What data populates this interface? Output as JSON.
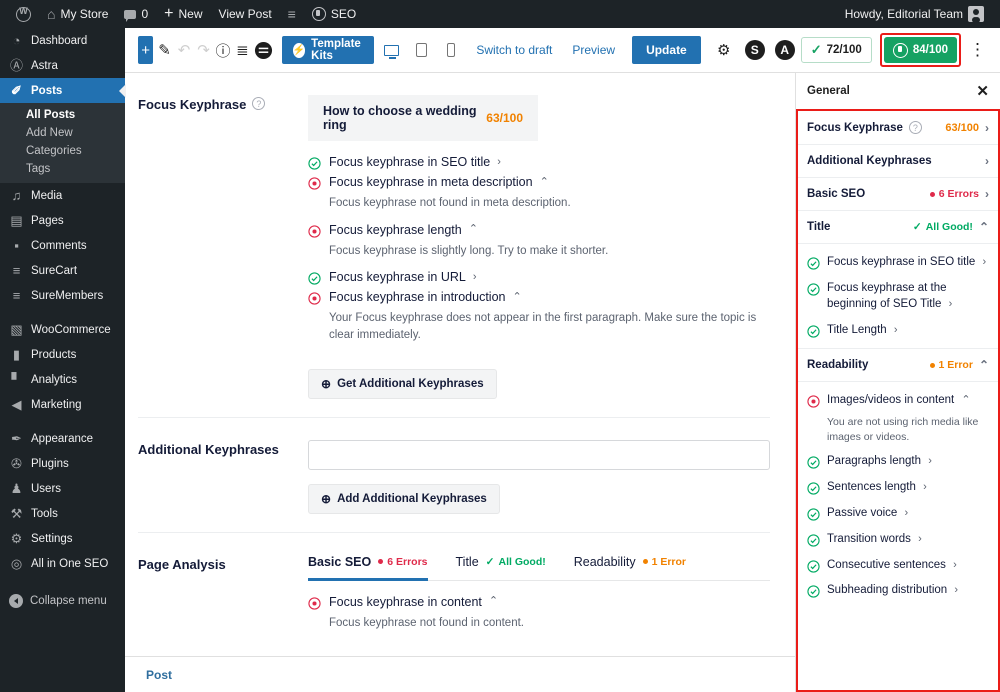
{
  "adminbar": {
    "site_name": "My Store",
    "comment_count": "0",
    "new_label": "New",
    "view_post_label": "View Post",
    "seo_label": "SEO",
    "howdy": "Howdy, Editorial Team",
    "icons": {
      "wp_logo": "wordpress-logo-icon",
      "home": "home-icon",
      "comment": "comment-icon",
      "plus": "plus-icon",
      "surecart": "surecart-icon",
      "aioseo": "aioseo-icon",
      "avatar": "user-avatar-icon"
    }
  },
  "sidebar": {
    "items": [
      {
        "label": "Dashboard",
        "icon": "dashboard-icon",
        "glyph": "◔"
      },
      {
        "label": "Astra",
        "icon": "astra-icon",
        "glyph": "Ⓐ"
      },
      {
        "label": "Posts",
        "icon": "pin-icon",
        "glyph": "✐",
        "current": true
      },
      {
        "label": "Media",
        "icon": "media-icon",
        "glyph": "♫"
      },
      {
        "label": "Pages",
        "icon": "pages-icon",
        "glyph": "▤"
      },
      {
        "label": "Comments",
        "icon": "comments-icon",
        "glyph": "■"
      },
      {
        "label": "SureCart",
        "icon": "surecart-icon",
        "glyph": "≡"
      },
      {
        "label": "SureMembers",
        "icon": "suremembers-icon",
        "glyph": "≡"
      },
      {
        "label": "WooCommerce",
        "icon": "woocommerce-icon",
        "glyph": "▧"
      },
      {
        "label": "Products",
        "icon": "products-icon",
        "glyph": "▮"
      },
      {
        "label": "Analytics",
        "icon": "analytics-icon",
        "glyph": "▐"
      },
      {
        "label": "Marketing",
        "icon": "marketing-icon",
        "glyph": "◀"
      },
      {
        "label": "Appearance",
        "icon": "appearance-icon",
        "glyph": "✒"
      },
      {
        "label": "Plugins",
        "icon": "plugins-icon",
        "glyph": "✇"
      },
      {
        "label": "Users",
        "icon": "users-icon",
        "glyph": "♟"
      },
      {
        "label": "Tools",
        "icon": "tools-icon",
        "glyph": "⚒"
      },
      {
        "label": "Settings",
        "icon": "settings-icon",
        "glyph": "⚙"
      },
      {
        "label": "All in One SEO",
        "icon": "aioseo-icon",
        "glyph": "◎"
      }
    ],
    "posts_submenu": [
      {
        "label": "All Posts",
        "current": true
      },
      {
        "label": "Add New",
        "current": false
      },
      {
        "label": "Categories",
        "current": false
      },
      {
        "label": "Tags",
        "current": false
      }
    ],
    "collapse_label": "Collapse menu"
  },
  "toolbar": {
    "add_block": "+",
    "tools_icon": "pencil-tool-icon",
    "undo_icon": "undo-icon",
    "redo_icon": "redo-icon",
    "info_icon": "document-info-icon",
    "outline_icon": "list-view-icon",
    "elementor_icon": "elementor-icon",
    "template_kits_label": "Template Kits",
    "desktop_icon": "desktop-preview-icon",
    "tablet_icon": "tablet-preview-icon",
    "mobile_icon": "mobile-preview-icon",
    "switch_to_draft": "Switch to draft",
    "preview": "Preview",
    "update": "Update",
    "settings_icon": "settings-gear-icon",
    "badge_s": "S",
    "badge_a": "A",
    "score_left": "72/100",
    "score_right": "84/100",
    "options_icon": "kebab-menu-icon"
  },
  "focus_keyphrase": {
    "section_label": "Focus Keyphrase",
    "keyphrase": "How to choose a wedding ring",
    "score": "63/100",
    "checks": [
      {
        "status": "good",
        "label": "Focus keyphrase in SEO title",
        "desc": ""
      },
      {
        "status": "error",
        "label": "Focus keyphrase in meta description",
        "desc": "Focus keyphrase not found in meta description."
      },
      {
        "status": "error",
        "label": "Focus keyphrase length",
        "desc": "Focus keyphrase is slightly long. Try to make it shorter."
      },
      {
        "status": "good",
        "label": "Focus keyphrase in URL",
        "desc": ""
      },
      {
        "status": "error",
        "label": "Focus keyphrase in introduction",
        "desc": "Your Focus keyphrase does not appear in the first paragraph. Make sure the topic is clear immediately."
      }
    ],
    "get_additional_button": "Get Additional Keyphrases"
  },
  "additional_keyphrases": {
    "section_label": "Additional Keyphrases",
    "input_value": "",
    "input_placeholder": "",
    "add_button": "Add Additional Keyphrases"
  },
  "page_analysis": {
    "section_label": "Page Analysis",
    "tabs": [
      {
        "label": "Basic SEO",
        "badge": "6 Errors",
        "state": "error",
        "active": true
      },
      {
        "label": "Title",
        "badge": "All Good!",
        "state": "good",
        "active": false
      },
      {
        "label": "Readability",
        "badge": "1 Error",
        "state": "warn",
        "active": false
      }
    ],
    "checks": [
      {
        "status": "error",
        "label": "Focus keyphrase in content",
        "desc": "Focus keyphrase not found in content."
      }
    ]
  },
  "bottom_bar": {
    "breadcrumb": "Post"
  },
  "right_panel": {
    "title": "General",
    "close_icon": "close-icon",
    "sections": [
      {
        "name": "Focus Keyphrase",
        "help": true,
        "score": "63/100",
        "chev": "right",
        "badge": null,
        "badge_state": null
      },
      {
        "name": "Additional Keyphrases",
        "help": false,
        "score": null,
        "chev": "right",
        "badge": null,
        "badge_state": null
      },
      {
        "name": "Basic SEO",
        "help": false,
        "score": null,
        "chev": "right",
        "badge": "6 Errors",
        "badge_state": "error"
      },
      {
        "name": "Title",
        "help": false,
        "score": null,
        "chev": "up",
        "badge": "All Good!",
        "badge_state": "good"
      }
    ],
    "title_items": [
      {
        "status": "good",
        "label": "Focus keyphrase in SEO title",
        "note": ""
      },
      {
        "status": "good",
        "label": "Focus keyphrase at the beginning of SEO Title",
        "note": ""
      },
      {
        "status": "good",
        "label": "Title Length",
        "note": ""
      }
    ],
    "readability": {
      "name": "Readability",
      "badge": "1 Error",
      "badge_state": "warn",
      "chev": "up"
    },
    "readability_items": [
      {
        "status": "error",
        "label": "Images/videos in content",
        "note": "You are not using rich media like images or videos."
      },
      {
        "status": "good",
        "label": "Paragraphs length",
        "note": ""
      },
      {
        "status": "good",
        "label": "Sentences length",
        "note": ""
      },
      {
        "status": "good",
        "label": "Passive voice",
        "note": ""
      },
      {
        "status": "good",
        "label": "Transition words",
        "note": ""
      },
      {
        "status": "good",
        "label": "Consecutive sentences",
        "note": ""
      },
      {
        "status": "good",
        "label": "Subheading distribution",
        "note": ""
      }
    ]
  },
  "colors": {
    "wp_blue": "#2271b1",
    "admin_dark": "#1d2327",
    "error_red": "#df2a4a",
    "warn_orange": "#f18200",
    "good_green": "#00aa63",
    "score_green": "#16a263",
    "highlight_red": "#ea1c18"
  }
}
